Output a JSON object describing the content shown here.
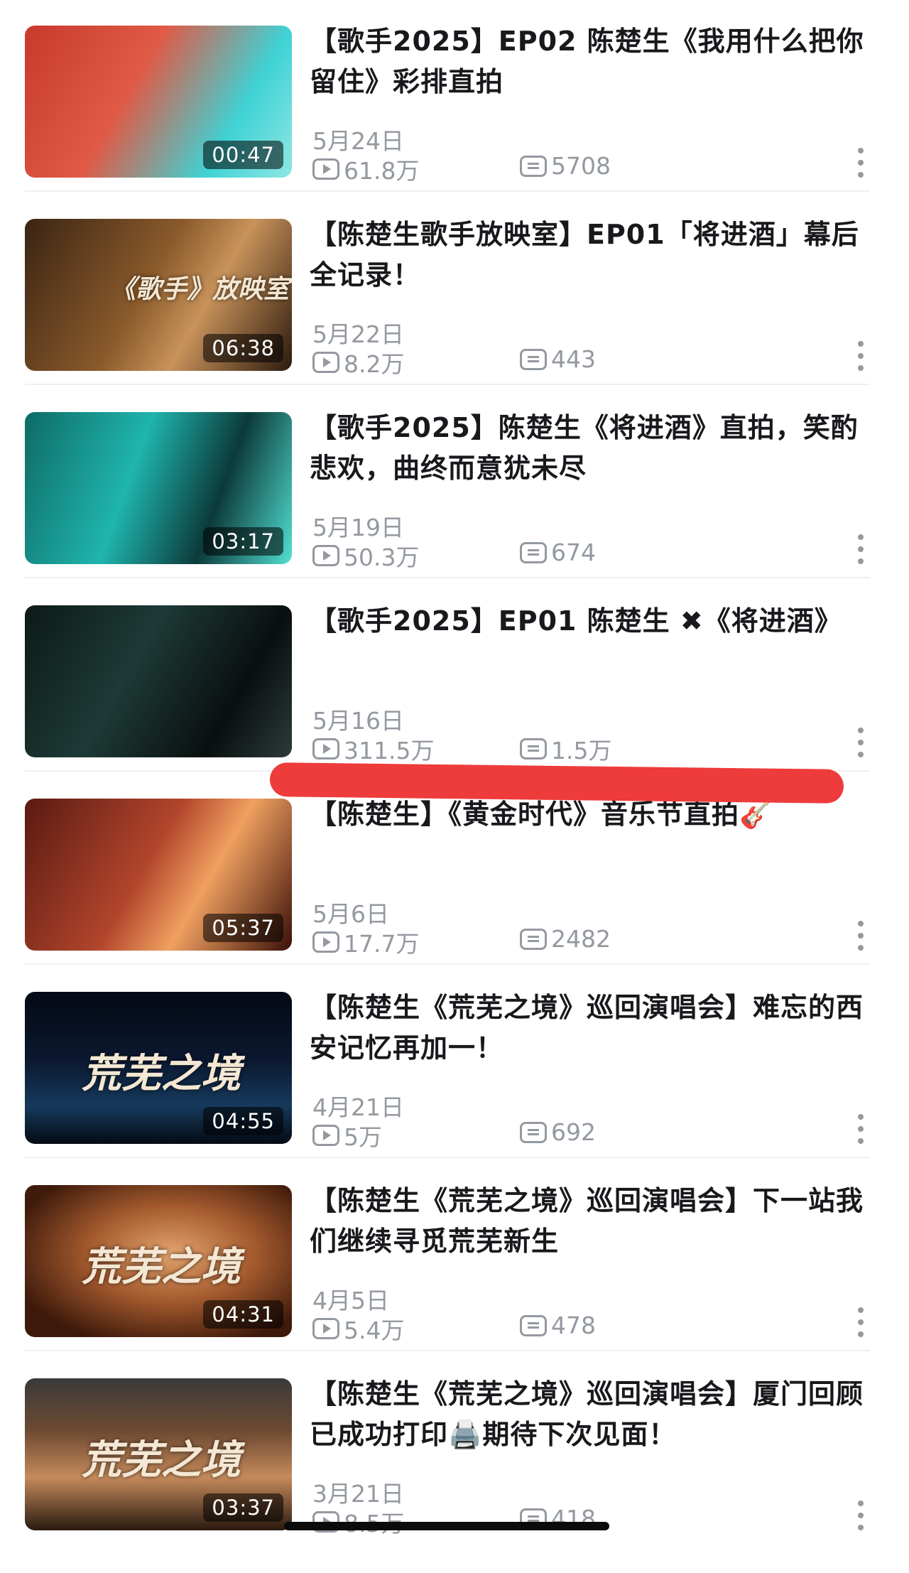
{
  "videos": [
    {
      "title": "【歌手2025】EP02 陈楚生《我用什么把你留住》彩排直拍",
      "date": "5月24日",
      "views": "61.8万",
      "comments": "5708",
      "duration": "00:47",
      "thumb_bg": "linear-gradient(120deg,#c73a2c 0%,#e05a46 40%,#3fd2d5 75%,#8fe7e3 100%)",
      "overlay": ""
    },
    {
      "title": "【陈楚生歌手放映室】EP01「将进酒」幕后全记录！",
      "date": "5月22日",
      "views": "8.2万",
      "comments": "443",
      "duration": "06:38",
      "thumb_bg": "linear-gradient(120deg,#3a2413 0%,#8a5a2b 45%,#c8925a 65%,#2b1a0d 100%)",
      "overlay": "《歌手》放映室"
    },
    {
      "title": "【歌手2025】陈楚生《将进酒》直拍，笑酌悲欢，曲终而意犹未尽",
      "date": "5月19日",
      "views": "50.3万",
      "comments": "674",
      "duration": "03:17",
      "thumb_bg": "linear-gradient(110deg,#0f6b66 0%,#1fb5ad 40%,#0c3a3b 70%,#52e0d2 100%)",
      "overlay": ""
    },
    {
      "title": "【歌手2025】EP01 陈楚生 ✖《将进酒》",
      "date": "5月16日",
      "views": "311.5万",
      "comments": "1.5万",
      "duration": "",
      "thumb_bg": "linear-gradient(120deg,#0c1a18 0%,#1d3a36 40%,#0a0f0f 75%,#2c3a3a 100%)",
      "overlay": ""
    },
    {
      "title": "【陈楚生】《黄金时代》音乐节直拍🎸",
      "date": "5月6日",
      "views": "17.7万",
      "comments": "2482",
      "duration": "05:37",
      "thumb_bg": "linear-gradient(120deg,#5a1a12 0%,#b2452c 45%,#f0a060 65%,#3a1008 100%)",
      "overlay": ""
    },
    {
      "title": "【陈楚生《荒芜之境》巡回演唱会】难忘的西安记忆再加一！",
      "date": "4月21日",
      "views": "5万",
      "comments": "692",
      "duration": "04:55",
      "thumb_bg": "linear-gradient(180deg,#040a14 0%,#0b1830 45%,#163a5c 75%,#050a12 100%)",
      "overlay": "荒芜之境"
    },
    {
      "title": "【陈楚生《荒芜之境》巡回演唱会】下一站我们继续寻觅荒芜新生",
      "date": "4月5日",
      "views": "5.4万",
      "comments": "478",
      "duration": "04:31",
      "thumb_bg": "radial-gradient(ellipse at 55% 45%,#e3a36e 0%,#a45a2e 40%,#3e1a0b 80%)",
      "overlay": "荒芜之境"
    },
    {
      "title": "【陈楚生《荒芜之境》巡回演唱会】厦门回顾已成功打印🖨️期待下次见面！",
      "date": "3月21日",
      "views": "8.5万",
      "comments": "418",
      "duration": "03:37",
      "thumb_bg": "linear-gradient(180deg,#3a3a3a 0%,#6e4a32 35%,#c68b5c 65%,#2a1a10 100%)",
      "overlay": "荒芜之境"
    }
  ]
}
